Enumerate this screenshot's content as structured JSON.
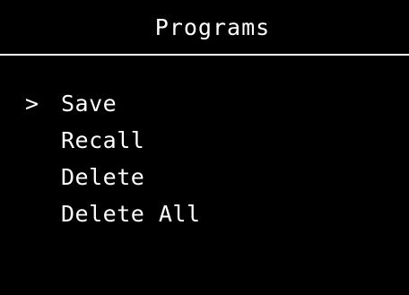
{
  "header": {
    "title": "Programs"
  },
  "menu": {
    "cursor_glyph": ">",
    "selected_index": 0,
    "items": [
      {
        "label": "Save"
      },
      {
        "label": "Recall"
      },
      {
        "label": "Delete"
      },
      {
        "label": "Delete All"
      }
    ]
  },
  "colors": {
    "background": "#000000",
    "foreground": "#ffffff"
  }
}
